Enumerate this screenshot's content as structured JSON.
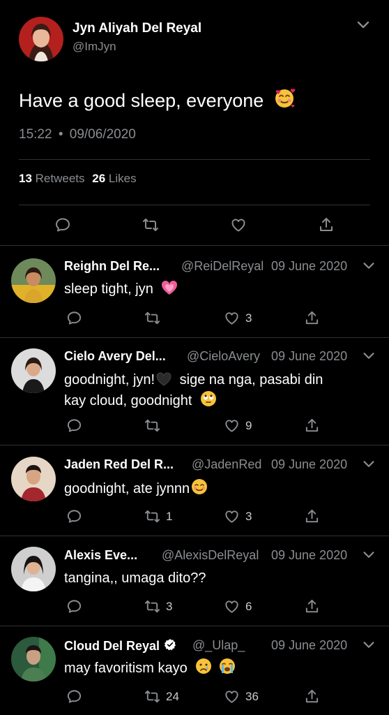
{
  "main_tweet": {
    "author_name": "Jyn Aliyah Del Reyal",
    "author_handle": "@ImJyn",
    "text": "Have a good sleep, everyone",
    "emoji": "smiling-face-with-hearts",
    "time": "15:22",
    "separator": "•",
    "date": "09/06/2020",
    "retweets_count": "13",
    "retweets_label": "Retweets",
    "likes_count": "26",
    "likes_label": "Likes"
  },
  "replies": [
    {
      "name": "Reighn Del Re...",
      "handle": "@ReiDelReyal",
      "date": "09 June 2020",
      "text": "sleep tight, jyn",
      "emoji": "pink-heart",
      "replies": "",
      "retweets": "",
      "likes": "3"
    },
    {
      "name": "Cielo Avery Del...",
      "handle": "@CieloAvery",
      "date": "09 June 2020",
      "text_line1": "goodnight, jyn!",
      "text_line1b": "sige na nga, pasabi din",
      "text_line2": "kay cloud, goodnight",
      "emoji1": "black-heart",
      "emoji2": "rolling-eyes",
      "replies": "",
      "retweets": "",
      "likes": "9"
    },
    {
      "name": "Jaden Red Del R...",
      "handle": "@JadenRed",
      "date": "09 June 2020",
      "text": "goodnight, ate jynnn",
      "emoji": "smiling-face",
      "replies": "",
      "retweets": "1",
      "likes": "3"
    },
    {
      "name": "Alexis Eve...",
      "handle": "@AlexisDelReyal",
      "date": "09 June 2020",
      "text": "tangina,, umaga dito??",
      "replies": "",
      "retweets": "3",
      "likes": "6"
    },
    {
      "name": "Cloud Del Reyal",
      "verified": true,
      "handle": "@_Ulap_",
      "date": "09 June 2020",
      "text": "may favoritism kayo",
      "emoji1": "crying-face",
      "emoji2": "loudly-crying-face",
      "replies": "",
      "retweets": "24",
      "likes": "36"
    }
  ],
  "colors": {
    "background": "#000000",
    "text": "#ffffff",
    "muted": "#8a8d91",
    "divider": "#2f3336"
  }
}
